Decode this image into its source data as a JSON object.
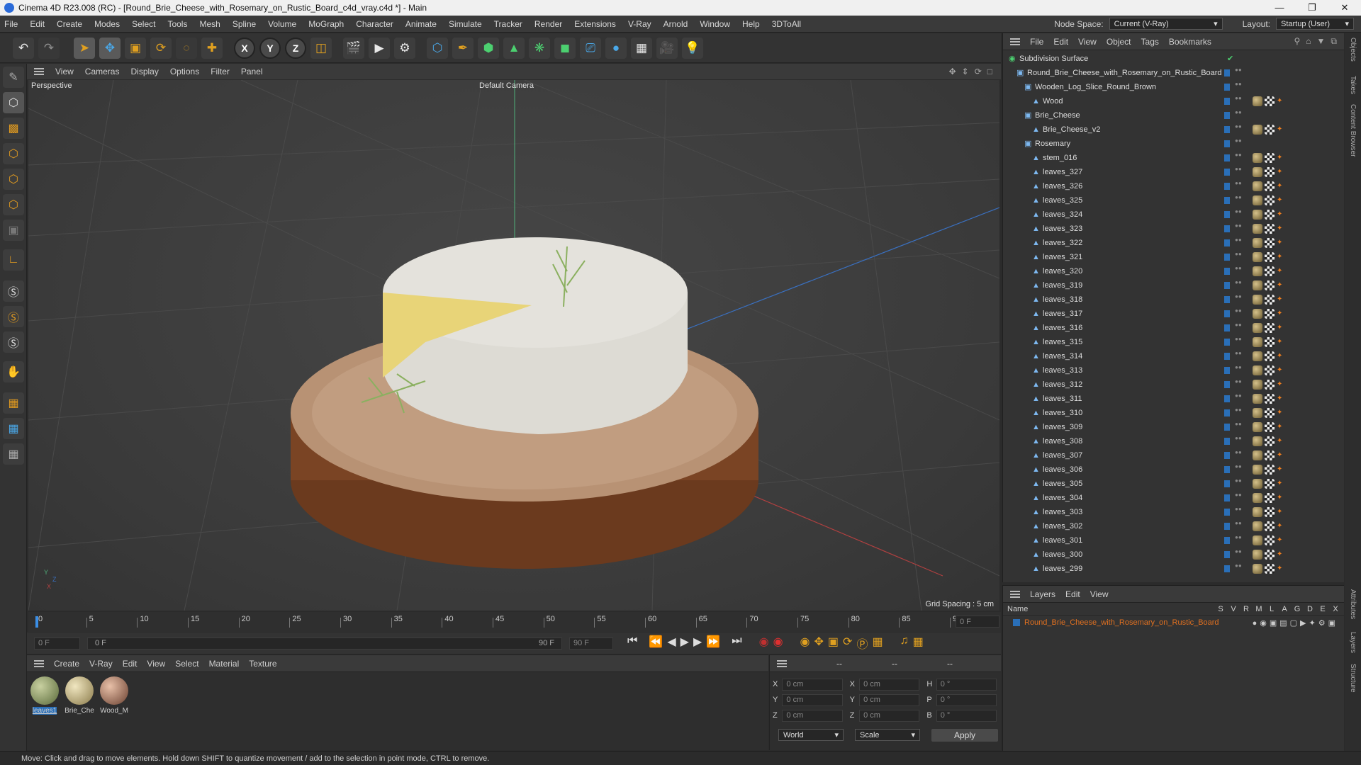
{
  "window": {
    "title": "Cinema 4D R23.008 (RC) - [Round_Brie_Cheese_with_Rosemary_on_Rustic_Board_c4d_vray.c4d *] - Main"
  },
  "menu": [
    "File",
    "Edit",
    "Create",
    "Modes",
    "Select",
    "Tools",
    "Mesh",
    "Spline",
    "Volume",
    "MoGraph",
    "Character",
    "Animate",
    "Simulate",
    "Tracker",
    "Render",
    "Extensions",
    "V-Ray",
    "Arnold",
    "Window",
    "Help",
    "3DToAll"
  ],
  "node_space": {
    "label": "Node Space:",
    "value": "Current (V-Ray)"
  },
  "layout": {
    "label": "Layout:",
    "value": "Startup (User)"
  },
  "viewport": {
    "menu": [
      "View",
      "Cameras",
      "Display",
      "Options",
      "Filter",
      "Panel"
    ],
    "name": "Perspective",
    "camera": "Default Camera",
    "grid_spacing": "Grid Spacing : 5 cm"
  },
  "timeline": {
    "ticks": [
      "0",
      "5",
      "10",
      "15",
      "20",
      "25",
      "30",
      "35",
      "40",
      "45",
      "50",
      "55",
      "60",
      "65",
      "70",
      "75",
      "80",
      "85",
      "90"
    ],
    "current": "0 F",
    "start": "0 F",
    "range_start": "0 F",
    "range_end": "90 F",
    "end": "90 F"
  },
  "material_panel": {
    "menu": [
      "Create",
      "V-Ray",
      "Edit",
      "View",
      "Select",
      "Material",
      "Texture"
    ],
    "materials": [
      {
        "name": "leaves1",
        "selected": true
      },
      {
        "name": "Brie_Che",
        "selected": false
      },
      {
        "name": "Wood_M",
        "selected": false
      }
    ]
  },
  "coords": {
    "headers": [
      "--",
      "--",
      "--"
    ],
    "rows": [
      {
        "a": "X",
        "av": "0 cm",
        "b": "X",
        "bv": "0 cm",
        "c": "H",
        "cv": "0 °"
      },
      {
        "a": "Y",
        "av": "0 cm",
        "b": "Y",
        "bv": "0 cm",
        "c": "P",
        "cv": "0 °"
      },
      {
        "a": "Z",
        "av": "0 cm",
        "b": "Z",
        "bv": "0 cm",
        "c": "B",
        "cv": "0 °"
      }
    ],
    "mode1": "World",
    "mode2": "Scale",
    "apply": "Apply"
  },
  "status": "Move: Click and drag to move elements. Hold down SHIFT to quantize movement / add to the selection in point mode, CTRL to remove.",
  "object_manager": {
    "menu": [
      "File",
      "Edit",
      "View",
      "Object",
      "Tags",
      "Bookmarks"
    ],
    "objects": [
      {
        "name": "Subdivision Surface",
        "indent": 0,
        "tags": "check"
      },
      {
        "name": "Round_Brie_Cheese_with_Rosemary_on_Rustic_Board",
        "indent": 1,
        "tags": ""
      },
      {
        "name": "Wooden_Log_Slice_Round_Brown",
        "indent": 2,
        "tags": ""
      },
      {
        "name": "Wood",
        "indent": 3,
        "tags": "mat"
      },
      {
        "name": "Brie_Cheese",
        "indent": 2,
        "tags": ""
      },
      {
        "name": "Brie_Cheese_v2",
        "indent": 3,
        "tags": "mat"
      },
      {
        "name": "Rosemary",
        "indent": 2,
        "tags": ""
      },
      {
        "name": "stem_016",
        "indent": 3,
        "tags": "mat"
      },
      {
        "name": "leaves_327",
        "indent": 3,
        "tags": "mat"
      },
      {
        "name": "leaves_326",
        "indent": 3,
        "tags": "mat"
      },
      {
        "name": "leaves_325",
        "indent": 3,
        "tags": "mat"
      },
      {
        "name": "leaves_324",
        "indent": 3,
        "tags": "mat"
      },
      {
        "name": "leaves_323",
        "indent": 3,
        "tags": "mat"
      },
      {
        "name": "leaves_322",
        "indent": 3,
        "tags": "mat"
      },
      {
        "name": "leaves_321",
        "indent": 3,
        "tags": "mat"
      },
      {
        "name": "leaves_320",
        "indent": 3,
        "tags": "mat"
      },
      {
        "name": "leaves_319",
        "indent": 3,
        "tags": "mat"
      },
      {
        "name": "leaves_318",
        "indent": 3,
        "tags": "mat"
      },
      {
        "name": "leaves_317",
        "indent": 3,
        "tags": "mat"
      },
      {
        "name": "leaves_316",
        "indent": 3,
        "tags": "mat"
      },
      {
        "name": "leaves_315",
        "indent": 3,
        "tags": "mat"
      },
      {
        "name": "leaves_314",
        "indent": 3,
        "tags": "mat"
      },
      {
        "name": "leaves_313",
        "indent": 3,
        "tags": "mat"
      },
      {
        "name": "leaves_312",
        "indent": 3,
        "tags": "mat"
      },
      {
        "name": "leaves_311",
        "indent": 3,
        "tags": "mat"
      },
      {
        "name": "leaves_310",
        "indent": 3,
        "tags": "mat"
      },
      {
        "name": "leaves_309",
        "indent": 3,
        "tags": "mat"
      },
      {
        "name": "leaves_308",
        "indent": 3,
        "tags": "mat"
      },
      {
        "name": "leaves_307",
        "indent": 3,
        "tags": "mat"
      },
      {
        "name": "leaves_306",
        "indent": 3,
        "tags": "mat"
      },
      {
        "name": "leaves_305",
        "indent": 3,
        "tags": "mat"
      },
      {
        "name": "leaves_304",
        "indent": 3,
        "tags": "mat"
      },
      {
        "name": "leaves_303",
        "indent": 3,
        "tags": "mat"
      },
      {
        "name": "leaves_302",
        "indent": 3,
        "tags": "mat"
      },
      {
        "name": "leaves_301",
        "indent": 3,
        "tags": "mat"
      },
      {
        "name": "leaves_300",
        "indent": 3,
        "tags": "mat"
      },
      {
        "name": "leaves_299",
        "indent": 3,
        "tags": "mat"
      }
    ]
  },
  "layer_manager": {
    "menu": [
      "Layers",
      "Edit",
      "View"
    ],
    "name_header": "Name",
    "flags": [
      "S",
      "V",
      "R",
      "M",
      "L",
      "A",
      "G",
      "D",
      "E",
      "X"
    ],
    "layers": [
      {
        "name": "Round_Brie_Cheese_with_Rosemary_on_Rustic_Board",
        "color": "#e07020"
      }
    ]
  },
  "side_tabs": [
    "Objects",
    "Takes",
    "Content Browser",
    "Attributes",
    "Layers",
    "Structure"
  ],
  "colors": {
    "accent": "#2a6fb8",
    "selection": "#f08020"
  }
}
